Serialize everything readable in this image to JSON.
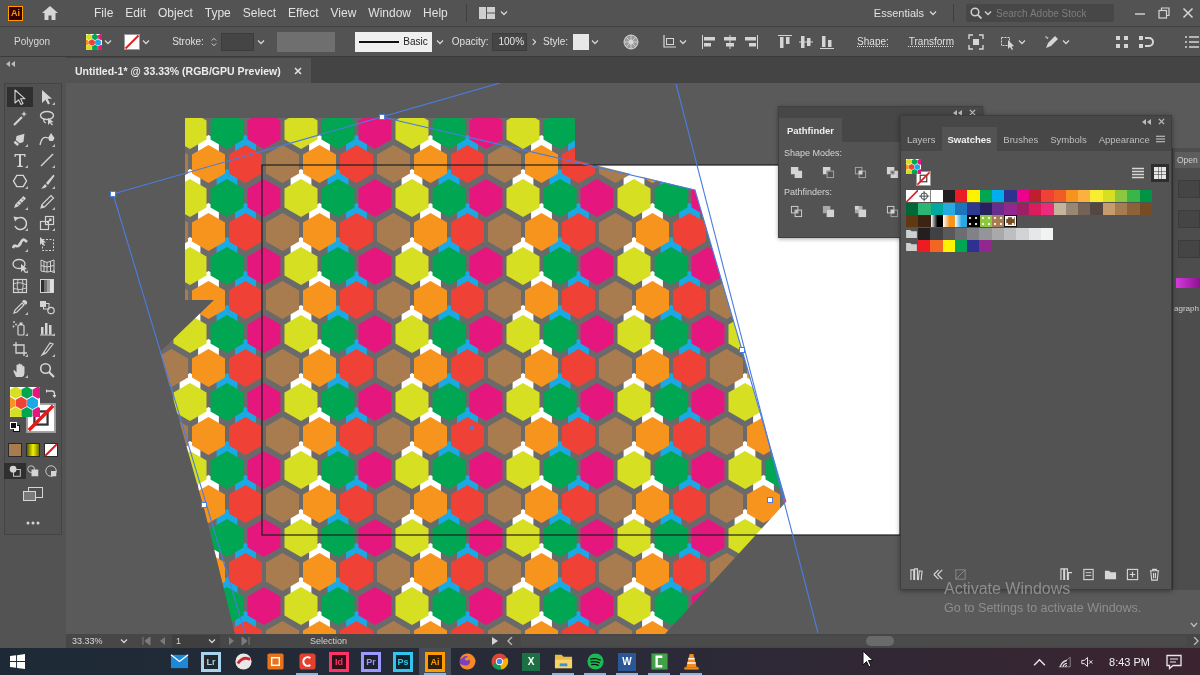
{
  "menu_bar": {
    "app_logo": "Ai",
    "menus": [
      "File",
      "Edit",
      "Object",
      "Type",
      "Select",
      "Effect",
      "View",
      "Window",
      "Help"
    ],
    "workspace": "Essentials",
    "search": {
      "placeholder": "Search Adobe Stock"
    }
  },
  "paint": {
    "fill": {
      "kind": "pattern"
    },
    "stroke": {
      "kind": "none"
    }
  },
  "control_bar": {
    "object_type": "Polygon",
    "stroke_label": "Stroke:",
    "brush": "Basic",
    "opacity_label": "Opacity:",
    "opacity": "100%",
    "style_label": "Style:",
    "shape_label": "Shape:",
    "transform": "Transform"
  },
  "document_tabs": [
    {
      "title": "Untitled-1* @ 33.33% (RGB/GPU Preview)",
      "selected": true
    }
  ],
  "tools": [
    {
      "selected": true
    },
    {
      "selected": false
    },
    {
      "selected": false
    },
    {
      "selected": false
    },
    {
      "selected": false
    },
    {
      "selected": false
    },
    {
      "selected": false
    },
    {
      "selected": false
    },
    {
      "selected": false
    },
    {
      "selected": false
    },
    {
      "selected": false
    },
    {
      "selected": false
    },
    {
      "selected": false
    },
    {
      "selected": false
    },
    {
      "selected": false
    },
    {
      "selected": false
    },
    {
      "selected": false
    },
    {
      "selected": false
    },
    {
      "selected": false
    },
    {
      "selected": false
    },
    {
      "selected": false
    },
    {
      "selected": false
    },
    {
      "selected": false
    },
    {
      "selected": false
    },
    {
      "selected": false
    },
    {
      "selected": false
    },
    {
      "selected": false
    },
    {
      "selected": false
    }
  ],
  "drawing_modes": [
    {
      "selected": true
    },
    {
      "selected": false
    },
    {
      "selected": false
    }
  ],
  "pathfinder": {
    "tab": "Pathfinder",
    "shape_modes_label": "Shape Modes:",
    "pathfinders_label": "Pathfinders:"
  },
  "swatches_panel": {
    "tabs": [
      {
        "label": "Layers",
        "selected": false
      },
      {
        "label": "Swatches",
        "selected": true
      },
      {
        "label": "Brushes",
        "selected": false
      },
      {
        "label": "Symbols",
        "selected": false
      },
      {
        "label": "Appearance",
        "selected": false
      }
    ],
    "views": [
      {
        "kind": "list",
        "selected": false
      },
      {
        "kind": "grid",
        "selected": true
      }
    ],
    "rows": [
      {
        "kind": "default",
        "swatches": [
          {
            "kind": "none",
            "selected": false
          },
          {
            "kind": "registration",
            "selected": false
          },
          {
            "kind": "solid",
            "color": "#ffffff",
            "selected": false
          },
          {
            "kind": "solid",
            "color": "#231f20",
            "selected": false
          },
          {
            "kind": "solid",
            "color": "#ed1c24",
            "selected": false
          },
          {
            "kind": "solid",
            "color": "#fff200",
            "selected": false
          },
          {
            "kind": "solid",
            "color": "#00a651",
            "selected": false
          },
          {
            "kind": "solid",
            "color": "#00aeef",
            "selected": false
          },
          {
            "kind": "solid",
            "color": "#2e3192",
            "selected": false
          },
          {
            "kind": "solid",
            "color": "#ec008c",
            "selected": false
          },
          {
            "kind": "solid",
            "color": "#be1e2d",
            "selected": false
          },
          {
            "kind": "solid",
            "color": "#ef4136",
            "selected": false
          },
          {
            "kind": "solid",
            "color": "#f15a29",
            "selected": false
          },
          {
            "kind": "solid",
            "color": "#f7941d",
            "selected": false
          },
          {
            "kind": "solid",
            "color": "#fbb040",
            "selected": false
          },
          {
            "kind": "solid",
            "color": "#f9ed32",
            "selected": false
          },
          {
            "kind": "solid",
            "color": "#d7df23",
            "selected": false
          },
          {
            "kind": "solid",
            "color": "#8dc63f",
            "selected": false
          },
          {
            "kind": "solid",
            "color": "#39b54a",
            "selected": false
          },
          {
            "kind": "solid",
            "color": "#009444",
            "selected": false
          }
        ]
      },
      {
        "kind": "default",
        "swatches": [
          {
            "kind": "solid",
            "color": "#006838",
            "selected": false
          },
          {
            "kind": "solid",
            "color": "#2bb673",
            "selected": false
          },
          {
            "kind": "solid",
            "color": "#00a79d",
            "selected": false
          },
          {
            "kind": "solid",
            "color": "#27aae1",
            "selected": false
          },
          {
            "kind": "solid",
            "color": "#1c75bc",
            "selected": false
          },
          {
            "kind": "solid",
            "color": "#2b3990",
            "selected": false
          },
          {
            "kind": "solid",
            "color": "#262262",
            "selected": false
          },
          {
            "kind": "solid",
            "color": "#662d91",
            "selected": false
          },
          {
            "kind": "solid",
            "color": "#92278f",
            "selected": false
          },
          {
            "kind": "solid",
            "color": "#9e1f63",
            "selected": false
          },
          {
            "kind": "solid",
            "color": "#da1c5c",
            "selected": false
          },
          {
            "kind": "solid",
            "color": "#ee2a7b",
            "selected": false
          },
          {
            "kind": "solid",
            "color": "#c2b59b",
            "selected": false
          },
          {
            "kind": "solid",
            "color": "#998675",
            "selected": false
          },
          {
            "kind": "solid",
            "color": "#736357",
            "selected": false
          },
          {
            "kind": "solid",
            "color": "#534741",
            "selected": false
          },
          {
            "kind": "solid",
            "color": "#c69c6d",
            "selected": false
          },
          {
            "kind": "solid",
            "color": "#a67c52",
            "selected": false
          },
          {
            "kind": "solid",
            "color": "#8c6239",
            "selected": false
          },
          {
            "kind": "solid",
            "color": "#754c24",
            "selected": false
          }
        ]
      },
      {
        "kind": "default",
        "swatches": [
          {
            "kind": "solid",
            "color": "#603913",
            "selected": false
          },
          {
            "kind": "solid",
            "color": "#3c2415",
            "selected": false
          },
          {
            "kind": "gradient",
            "color": "#000000",
            "selected": false
          },
          {
            "kind": "gradient",
            "color": "#f7941d",
            "selected": false
          },
          {
            "kind": "gradient",
            "color": "#27aae1",
            "selected": false
          },
          {
            "kind": "pattern",
            "color": "#000000",
            "selected": false
          },
          {
            "kind": "pattern",
            "color": "#8dc63f",
            "selected": false
          },
          {
            "kind": "pattern",
            "color": "#a67c52",
            "selected": false
          },
          {
            "kind": "pattern",
            "color": "#754c24",
            "selected": true
          }
        ]
      },
      {
        "kind": "group",
        "swatches": [
          {
            "kind": "solid",
            "color": "#231f20",
            "selected": false
          },
          {
            "kind": "solid",
            "color": "#414042",
            "selected": false
          },
          {
            "kind": "solid",
            "color": "#58595b",
            "selected": false
          },
          {
            "kind": "solid",
            "color": "#6d6e71",
            "selected": false
          },
          {
            "kind": "solid",
            "color": "#808285",
            "selected": false
          },
          {
            "kind": "solid",
            "color": "#939598",
            "selected": false
          },
          {
            "kind": "solid",
            "color": "#a7a9ac",
            "selected": false
          },
          {
            "kind": "solid",
            "color": "#bcbec0",
            "selected": false
          },
          {
            "kind": "solid",
            "color": "#d1d3d4",
            "selected": false
          },
          {
            "kind": "solid",
            "color": "#e6e7e8",
            "selected": false
          },
          {
            "kind": "solid",
            "color": "#f1f2f2",
            "selected": false
          }
        ]
      },
      {
        "kind": "group",
        "swatches": [
          {
            "kind": "solid",
            "color": "#ed1c24",
            "selected": false
          },
          {
            "kind": "solid",
            "color": "#f26522",
            "selected": false
          },
          {
            "kind": "solid",
            "color": "#fff200",
            "selected": false
          },
          {
            "kind": "solid",
            "color": "#00a651",
            "selected": false
          },
          {
            "kind": "solid",
            "color": "#2e3191",
            "selected": false
          },
          {
            "kind": "solid",
            "color": "#92278f",
            "selected": false
          }
        ]
      }
    ]
  },
  "right_dock": {
    "button": "Open",
    "label": "agraph"
  },
  "status_bar": {
    "zoom": "33.33%",
    "artboard": "1",
    "tool": "Selection"
  },
  "activation_notice": {
    "title": "Activate Windows",
    "message": "Go to Settings to activate Windows."
  },
  "taskbar": {
    "apps": [
      {
        "kind": "envelope",
        "running": false,
        "active": false
      },
      {
        "kind": "letter-tile",
        "label": "Lr",
        "color": "#a8d4ee",
        "running": false,
        "active": false
      },
      {
        "kind": "disc",
        "running": false,
        "active": false
      },
      {
        "kind": "square",
        "running": false,
        "active": false
      },
      {
        "kind": "rounded-c",
        "running": true,
        "active": false
      },
      {
        "kind": "letter-tile",
        "label": "Id",
        "color": "#ff3366",
        "running": false,
        "active": false
      },
      {
        "kind": "letter-tile",
        "label": "Pr",
        "color": "#9999ff",
        "running": false,
        "active": false
      },
      {
        "kind": "letter-tile",
        "label": "Ps",
        "color": "#31c5f0",
        "running": false,
        "active": false
      },
      {
        "kind": "letter-tile",
        "label": "Ai",
        "color": "#ff9a00",
        "running": true,
        "active": true
      },
      {
        "kind": "globe",
        "running": false,
        "active": false
      },
      {
        "kind": "circle-logo",
        "running": false,
        "active": false
      },
      {
        "kind": "office-tile",
        "label": "X",
        "color": "#1d7044",
        "running": false,
        "active": false
      },
      {
        "kind": "folder",
        "running": true,
        "active": false
      },
      {
        "kind": "sound-waves",
        "running": true,
        "active": false
      },
      {
        "kind": "office-tile",
        "label": "W",
        "color": "#2b5797",
        "running": true,
        "active": false
      },
      {
        "kind": "bracket",
        "running": true,
        "active": false
      },
      {
        "kind": "cone",
        "running": true,
        "active": false
      }
    ],
    "clock": "8:43 PM"
  }
}
